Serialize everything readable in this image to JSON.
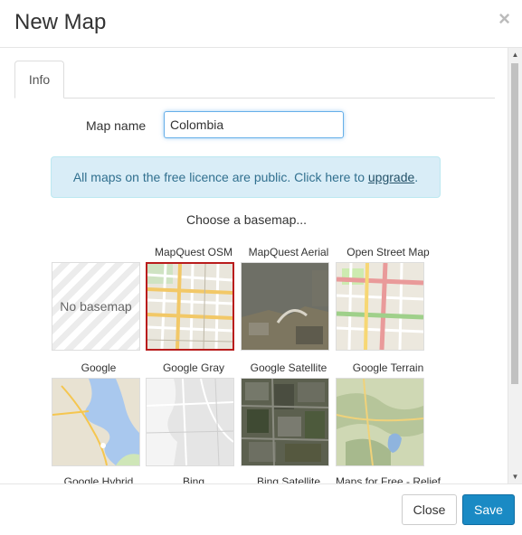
{
  "modal": {
    "title": "New Map",
    "close_symbol": "×"
  },
  "tabs": [
    {
      "label": "Info"
    }
  ],
  "form": {
    "map_name_label": "Map name",
    "map_name_value": "Colombia"
  },
  "alert": {
    "text": "All maps on the free licence are public. Click here to",
    "link": "upgrade",
    "suffix": "."
  },
  "choose_label": "Choose a basemap...",
  "basemaps": {
    "no_basemap": "No basemap",
    "mapquest_osm": "MapQuest OSM",
    "mapquest_aerial": "MapQuest Aerial",
    "open_street_map": "Open Street Map",
    "google": "Google",
    "google_gray": "Google Gray",
    "google_satellite": "Google Satellite",
    "google_terrain": "Google Terrain",
    "google_hybrid": "Google Hybrid",
    "bing": "Bing",
    "bing_satellite": "Bing Satellite",
    "maps_for_free_relief": "Maps for Free - Relief"
  },
  "selected_basemap": "MapQuest OSM",
  "footer": {
    "close_label": "Close",
    "save_label": "Save"
  },
  "colors": {
    "accent": "#1a8ac4",
    "selected_border": "#b91c1c",
    "alert_bg": "#d9edf7"
  }
}
